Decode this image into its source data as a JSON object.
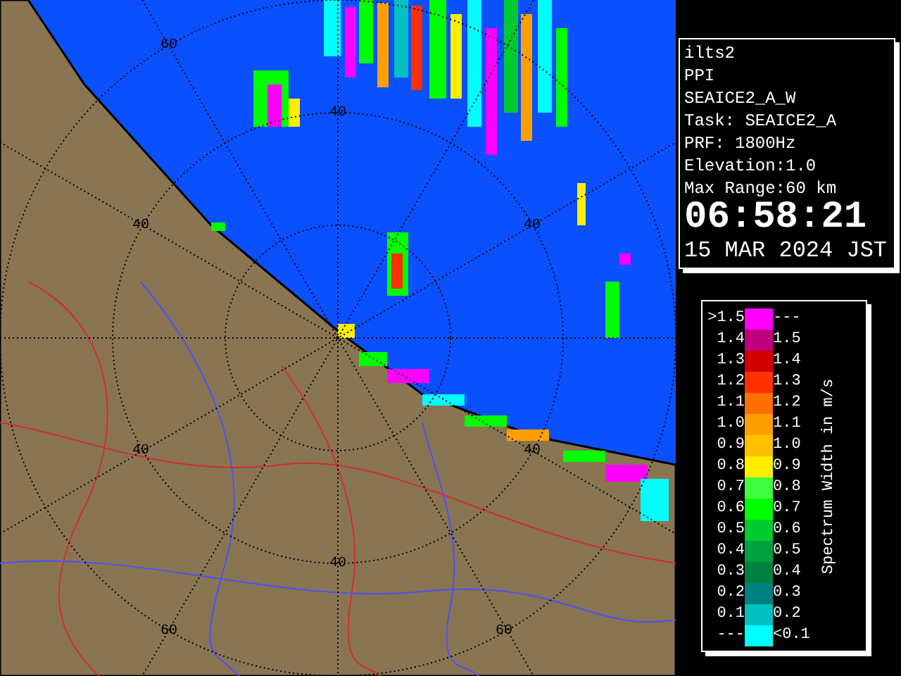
{
  "radar_map": {
    "range_labels": [
      "60",
      "40",
      "40",
      "40",
      "40",
      "40",
      "40",
      "60",
      "60"
    ]
  },
  "info_panel": {
    "lines": [
      "ilts2",
      "PPI",
      "SEAICE2_A_W",
      "Task: SEAICE2_A",
      "PRF: 1800Hz",
      "Elevation:1.0",
      "Max Range:60 km"
    ],
    "time": "06:58:21",
    "date": "15 MAR 2024 JST"
  },
  "legend": {
    "title": "Spectrum Width in m/s",
    "rows": [
      {
        "left_label": ">1.5",
        "right_label": "---",
        "color": "#ff00ff"
      },
      {
        "left_label": "1.4",
        "right_label": "1.5",
        "color": "#c0007a"
      },
      {
        "left_label": "1.3",
        "right_label": "1.4",
        "color": "#d00000"
      },
      {
        "left_label": "1.2",
        "right_label": "1.3",
        "color": "#ff3000"
      },
      {
        "left_label": "1.1",
        "right_label": "1.2",
        "color": "#ff7000"
      },
      {
        "left_label": "1.0",
        "right_label": "1.1",
        "color": "#ffa000"
      },
      {
        "left_label": "0.9",
        "right_label": "1.0",
        "color": "#ffc000"
      },
      {
        "left_label": "0.8",
        "right_label": "0.9",
        "color": "#ffee00"
      },
      {
        "left_label": "0.7",
        "right_label": "0.8",
        "color": "#40ff40"
      },
      {
        "left_label": "0.6",
        "right_label": "0.7",
        "color": "#00ff00"
      },
      {
        "left_label": "0.5",
        "right_label": "0.6",
        "color": "#00cc30"
      },
      {
        "left_label": "0.4",
        "right_label": "0.5",
        "color": "#00a040"
      },
      {
        "left_label": "0.3",
        "right_label": "0.4",
        "color": "#008040"
      },
      {
        "left_label": "0.2",
        "right_label": "0.3",
        "color": "#008080"
      },
      {
        "left_label": "0.1",
        "right_label": "0.2",
        "color": "#00c0c0"
      },
      {
        "left_label": "---",
        "right_label": "<0.1",
        "color": "#00ffff"
      }
    ]
  }
}
